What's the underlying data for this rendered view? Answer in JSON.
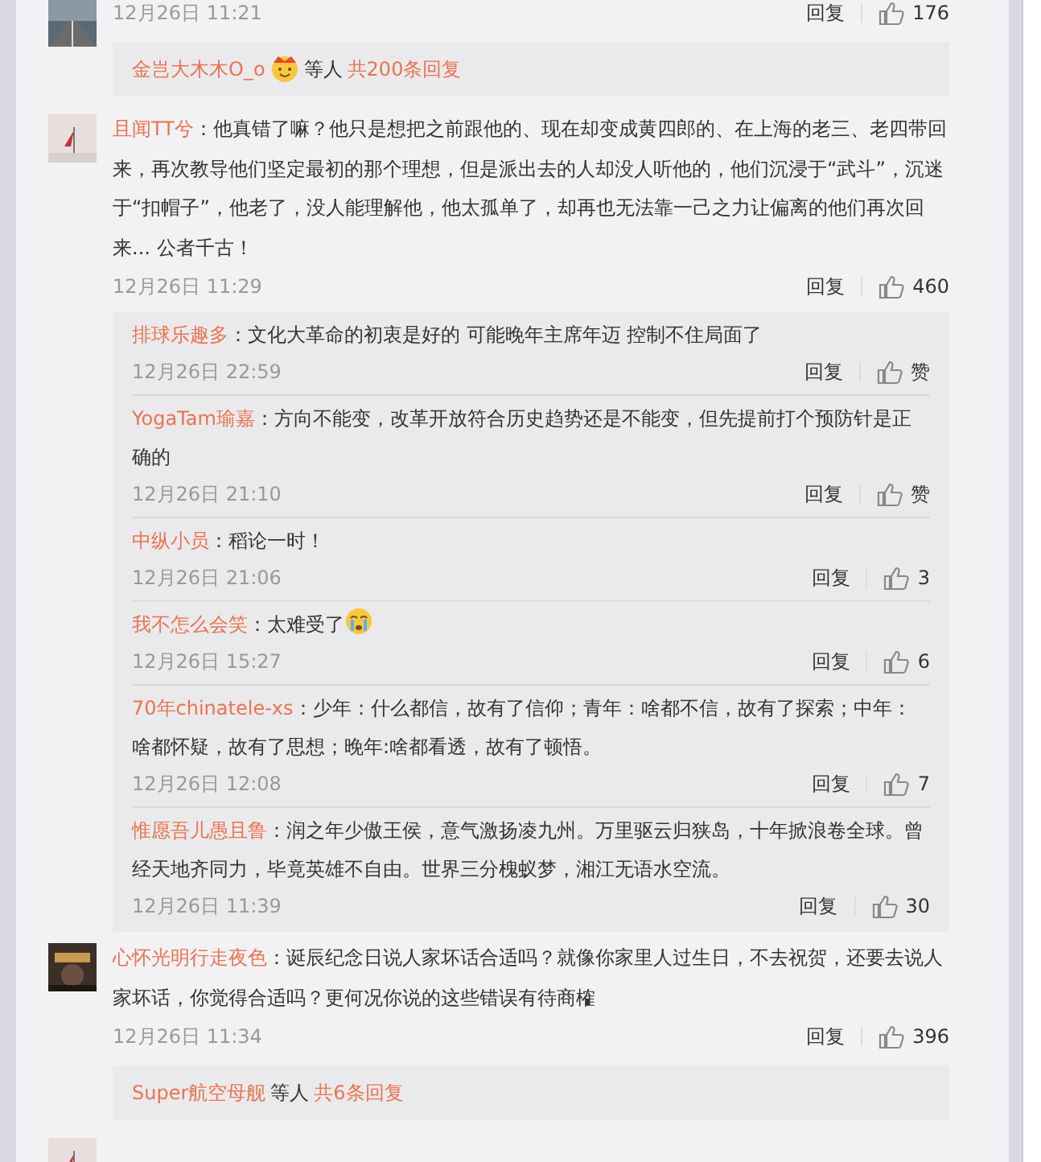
{
  "comments": [
    {
      "time": "12月26日 11:21",
      "reply": "回复",
      "likes": "176",
      "summary": {
        "user": "金岂大木木O_o",
        "emoji": true,
        "middle": "等人",
        "total": "共200条回复"
      }
    },
    {
      "user": "且闻TT兮",
      "text": "：他真错了嘛？他只是想把之前跟他的、现在却变成黄四郎的、在上海的老三、老四带回来，再次教导他们坚定最初的那个理想，但是派出去的人却没人听他的，他们沉浸于“武斗”，沉迷于“扣帽子”，他老了，没人能理解他，他太孤单了，却再也无法靠一己之力让偏离的他们再次回来... 公者千古！",
      "time": "12月26日 11:29",
      "reply": "回复",
      "likes": "460",
      "replies": [
        {
          "user": "排球乐趣多",
          "text": "：文化大革命的初衷是好的 可能晚年主席年迈 控制不住局面了",
          "emoji": false,
          "time": "12月26日 22:59",
          "reply": "回复",
          "likes": "赞"
        },
        {
          "user": "YogaTam瑜嘉",
          "text": "：方向不能变，改革开放符合历史趋势还是不能变，但先提前打个预防针是正确的",
          "emoji": false,
          "time": "12月26日 21:10",
          "reply": "回复",
          "likes": "赞"
        },
        {
          "user": "中纵小员",
          "text": "：稻论一时！",
          "emoji": false,
          "time": "12月26日 21:06",
          "reply": "回复",
          "likes": "3"
        },
        {
          "user": "我不怎么会笑",
          "text": "：太难受了",
          "emoji": true,
          "time": "12月26日 15:27",
          "reply": "回复",
          "likes": "6"
        },
        {
          "user": "70年chinatele-xs",
          "text": "：少年：什么都信，故有了信仰；青年：啥都不信，故有了探索；中年：啥都怀疑，故有了思想；晚年:啥都看透，故有了顿悟。",
          "emoji": false,
          "time": "12月26日 12:08",
          "reply": "回复",
          "likes": "7"
        },
        {
          "user": "惟愿吾儿愚且鲁",
          "text": "：润之年少傲王侯，意气激扬凌九州。万里驱云归狭岛，十年掀浪卷全球。曾经天地齐同力，毕竟英雄不自由。世界三分槐蚁梦，湘江无语水空流。",
          "emoji": false,
          "time": "12月26日 11:39",
          "reply": "回复",
          "likes": "30"
        }
      ]
    },
    {
      "user": "心怀光明行走夜色",
      "text": "：诞辰纪念日说人家坏话合适吗？就像你家里人过生日，不去祝贺，还要去说人家坏话，你觉得合适吗？更何况你说的这些错误有待商榷",
      "time": "12月26日 11:34",
      "reply": "回复",
      "likes": "396",
      "summary": {
        "user": "Super航空母舰",
        "emoji": false,
        "middle": "等人",
        "total": "共6条回复"
      }
    }
  ]
}
